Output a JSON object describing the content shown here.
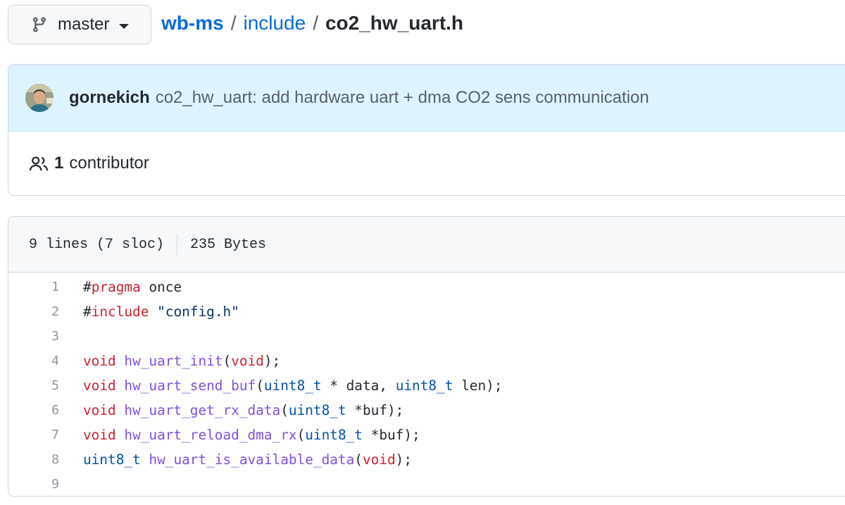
{
  "branch": {
    "name": "master"
  },
  "breadcrumb": {
    "repo": "wb-ms",
    "sep1": "/",
    "folder": "include",
    "sep2": "/",
    "file": "co2_hw_uart.h"
  },
  "commit": {
    "author": "gornekich",
    "message": "co2_hw_uart: add hardware uart + dma CO2 sens communication"
  },
  "contributors": {
    "count": "1",
    "label": "contributor"
  },
  "file_info": {
    "lines": "9 lines (7 sloc)",
    "size": "235 Bytes"
  },
  "code": {
    "line_numbers": [
      "1",
      "2",
      "3",
      "4",
      "5",
      "6",
      "7",
      "8",
      "9"
    ],
    "l1": [
      "#",
      "pragma",
      " once"
    ],
    "l2": [
      "#",
      "include",
      " ",
      "\"config.h\""
    ],
    "l4": [
      "void",
      " ",
      "hw_uart_init",
      "(",
      "void",
      ");"
    ],
    "l5": [
      "void",
      " ",
      "hw_uart_send_buf",
      "(",
      "uint8_t",
      " * data, ",
      "uint8_t",
      " len);"
    ],
    "l6": [
      "void",
      " ",
      "hw_uart_get_rx_data",
      "(",
      "uint8_t",
      " *buf);"
    ],
    "l7": [
      "void",
      " ",
      "hw_uart_reload_dma_rx",
      "(",
      "uint8_t",
      " *buf);"
    ],
    "l8": [
      "uint8_t",
      " ",
      "hw_uart_is_available_data",
      "(",
      "void",
      ");"
    ]
  },
  "colors": {
    "link": "#0969da",
    "keyword": "#cf222e",
    "function": "#8250df",
    "type": "#0550ae",
    "commit_bg": "#ddf4ff"
  },
  "icons": {
    "branch": "git-branch-icon",
    "contributors": "people-icon"
  }
}
